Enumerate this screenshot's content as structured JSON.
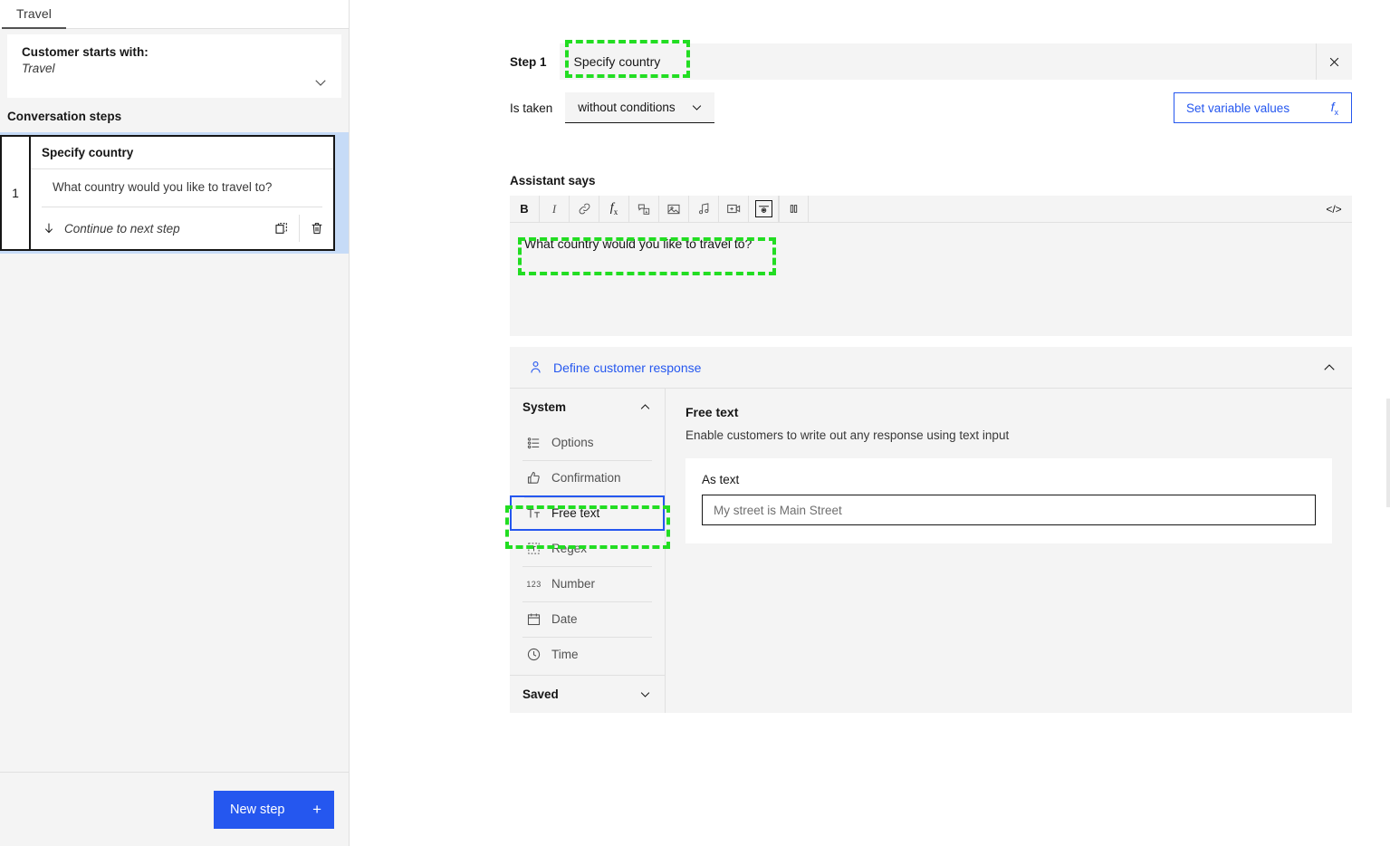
{
  "sidebar": {
    "tab": {
      "label": "Travel"
    },
    "starts_with": {
      "title": "Customer starts with:",
      "value": "Travel",
      "chevron_icon": "chevron-down-icon"
    },
    "steps_section_title": "Conversation steps",
    "steps": [
      {
        "number": "1",
        "name": "Specify country",
        "message": "What country would you like to travel to?",
        "transition": "Continue to next step",
        "transition_icon": "arrow-down-icon",
        "duplicate_icon": "duplicate-icon",
        "delete_icon": "trash-icon"
      }
    ],
    "new_step_button": {
      "label": "New step",
      "plus": "+"
    }
  },
  "main": {
    "step_label": "Step 1",
    "step_title_value": "Specify country",
    "close_icon": "close-icon",
    "condition": {
      "label": "Is taken",
      "selected": "without conditions",
      "chevron_icon": "chevron-down-icon"
    },
    "set_variable_values": {
      "label": "Set variable values",
      "icon": "fx-icon"
    },
    "assistant_says_label": "Assistant says",
    "editor": {
      "toolbar": [
        {
          "name": "bold-icon",
          "glyph": "B"
        },
        {
          "name": "italic-icon",
          "glyph": "I"
        },
        {
          "name": "link-icon",
          "glyph": "link"
        },
        {
          "name": "function-icon",
          "glyph": "fx"
        },
        {
          "name": "speech-variable-icon",
          "glyph": "speech"
        },
        {
          "name": "image-icon",
          "glyph": "image"
        },
        {
          "name": "audio-icon",
          "glyph": "music"
        },
        {
          "name": "video-icon",
          "glyph": "video"
        },
        {
          "name": "camera-icon",
          "glyph": "camera"
        },
        {
          "name": "pause-icon",
          "glyph": "pause"
        }
      ],
      "code_view_label": "</>",
      "content": "What country would you like to travel to?"
    },
    "define_customer_response": {
      "title": "Define customer response",
      "person_icon": "person-icon",
      "collapse_icon": "chevron-up-icon",
      "groups": {
        "system": {
          "label": "System",
          "chevron_icon": "chevron-up-icon"
        },
        "saved": {
          "label": "Saved",
          "chevron_icon": "chevron-down-icon"
        }
      },
      "types": [
        {
          "label": "Options",
          "icon": "options-icon",
          "selected": false
        },
        {
          "label": "Confirmation",
          "icon": "thumbs-up-icon",
          "selected": false
        },
        {
          "label": "Free text",
          "icon": "text-format-icon",
          "selected": true
        },
        {
          "label": "Regex",
          "icon": "regex-icon",
          "selected": false
        },
        {
          "label": "Number",
          "icon": "number-123-icon",
          "selected": false
        },
        {
          "label": "Date",
          "icon": "calendar-icon",
          "selected": false
        },
        {
          "label": "Time",
          "icon": "clock-icon",
          "selected": false
        }
      ],
      "detail": {
        "title": "Free text",
        "description": "Enable customers to write out any response using text input",
        "card_label": "As text",
        "input_placeholder": "My street is Main Street",
        "input_value": ""
      }
    }
  },
  "annotations": {
    "color": "#22dd22",
    "highlights": [
      {
        "name": "step-title-annotation"
      },
      {
        "name": "assistant-text-annotation"
      },
      {
        "name": "free-text-option-annotation"
      }
    ]
  },
  "colors": {
    "accent_blue": "#2557ef",
    "selected_row_blue": "#c6dbf7",
    "panel_gray": "#f4f4f4",
    "annotation_green": "#22dd22"
  }
}
